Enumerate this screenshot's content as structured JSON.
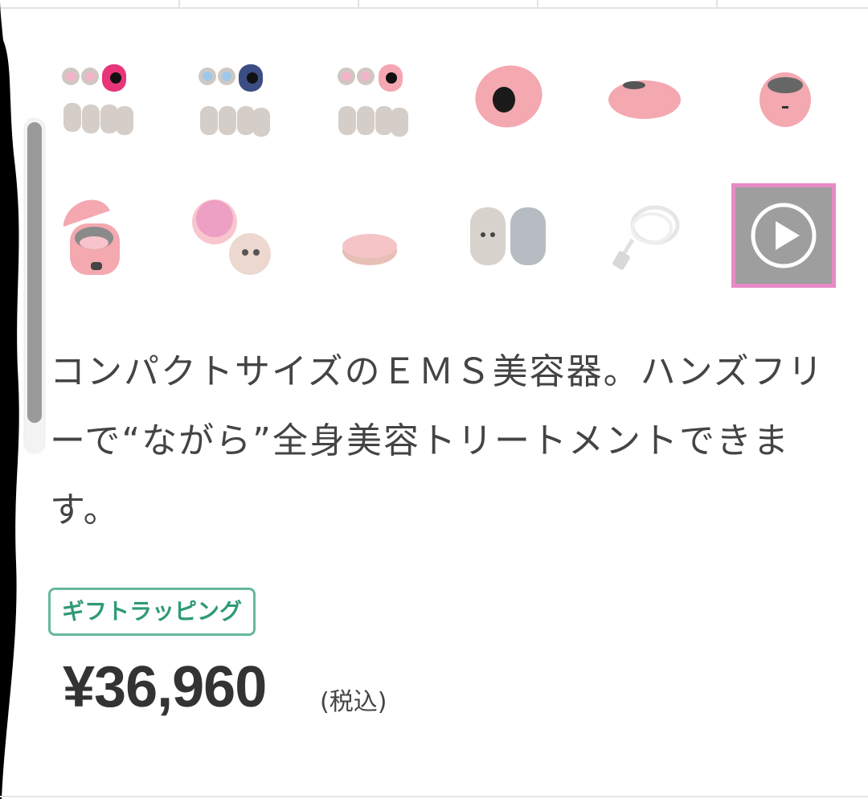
{
  "gallery": {
    "thumbnails": [
      {
        "label": "set-pink"
      },
      {
        "label": "set-navy"
      },
      {
        "label": "set-light-pink"
      },
      {
        "label": "device-front"
      },
      {
        "label": "device-side"
      },
      {
        "label": "device-back"
      },
      {
        "label": "charging-case-open"
      },
      {
        "label": "pads-round"
      },
      {
        "label": "charging-base"
      },
      {
        "label": "gel-pads"
      },
      {
        "label": "usb-cable"
      }
    ],
    "video_icon": "play-icon",
    "highlight_color": "#e88ac5"
  },
  "product": {
    "description": "コンパクトサイズのＥＭＳ美容器。ハンズフリーで“ながら”全身美容トリートメントできます。",
    "gift_badge": "ギフトラッピング",
    "price": "¥36,960",
    "tax_note": "(税込)"
  },
  "colors": {
    "badge_green": "#67b89c",
    "product_pink": "#f2a6ae",
    "scrollbar": "#9a9a9a"
  }
}
